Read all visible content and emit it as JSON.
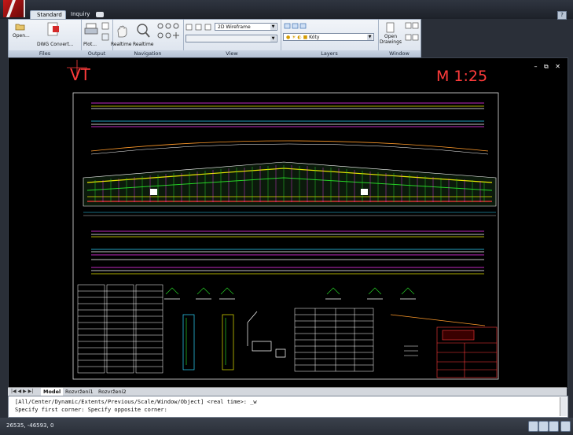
{
  "tabs": [
    "Standard",
    "Inquiry"
  ],
  "help_label": "?",
  "ribbon": {
    "files": {
      "title": "Files",
      "open_label": "Open...",
      "convert_label": "DWG Convert..."
    },
    "output": {
      "title": "Output",
      "plot_label": "Plot..."
    },
    "navigation": {
      "title": "Navigation",
      "realtime_pan_label": "Realtime",
      "realtime_zoom_label": "Realtime"
    },
    "view": {
      "title": "View",
      "visual_style": "2D Wireframe",
      "view_combo": ""
    },
    "layers": {
      "title": "Layers",
      "current_layer": "Kóty"
    },
    "window": {
      "title": "Window",
      "open_drawings_label": "Open Drawings"
    }
  },
  "drawing": {
    "title_vt": "VT",
    "scale_label": "M 1:25",
    "window_controls": "– ⧉ ✕"
  },
  "layout_tabs": [
    "Model",
    "Rozvržení1",
    "Rozvržení2"
  ],
  "command": {
    "line1": "[All/Center/Dynamic/Extents/Previous/Scale/Window/Object] <real time>: _w",
    "line2": "Specify first corner: Specify opposite corner:"
  },
  "status": {
    "coordinates": "26535, -46593, 0"
  },
  "colors": {
    "accent_red": "#ff3b3b",
    "truss_yellow": "#e6e600",
    "truss_green": "#27d427",
    "magenta": "#ff39ff",
    "cyan": "#2fd7ff"
  }
}
